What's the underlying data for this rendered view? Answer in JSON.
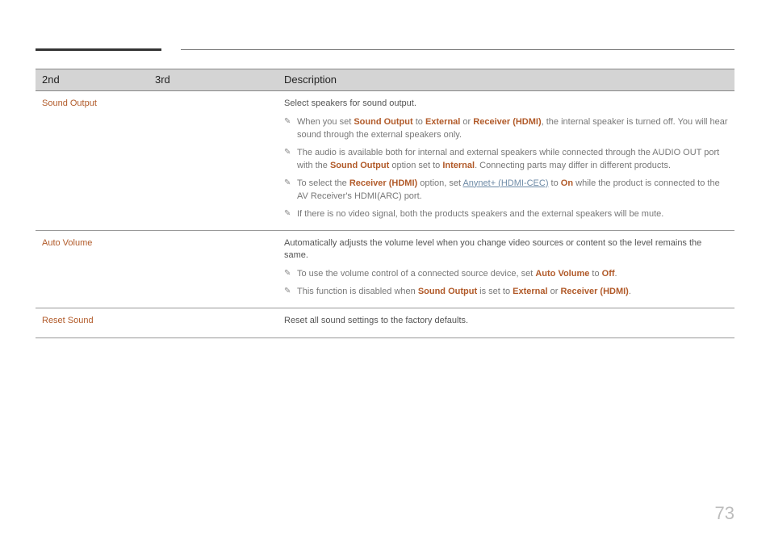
{
  "headers": {
    "col1": "2nd",
    "col2": "3rd",
    "col3": "Description"
  },
  "rows": [
    {
      "menu": "Sound Output",
      "desc_main": "Select speakers for sound output.",
      "notes": [
        [
          {
            "t": "When you set "
          },
          {
            "t": "Sound Output",
            "c": "hl-bold"
          },
          {
            "t": " to "
          },
          {
            "t": "External",
            "c": "hl-bold"
          },
          {
            "t": " or "
          },
          {
            "t": "Receiver (HDMI)",
            "c": "hl-bold"
          },
          {
            "t": ", the internal speaker is turned off. You will hear sound through the external speakers only."
          }
        ],
        [
          {
            "t": "The audio is available both for internal and external speakers while connected through the AUDIO OUT port with the "
          },
          {
            "t": "Sound Output",
            "c": "hl-bold"
          },
          {
            "t": " option set to "
          },
          {
            "t": "Internal",
            "c": "hl-bold"
          },
          {
            "t": ". Connecting parts may differ in different products."
          }
        ],
        [
          {
            "t": "To select the "
          },
          {
            "t": "Receiver (HDMI)",
            "c": "hl-bold"
          },
          {
            "t": " option, set "
          },
          {
            "t": "Anynet+ (HDMI-CEC)",
            "c": "link"
          },
          {
            "t": " to "
          },
          {
            "t": "On",
            "c": "hl-bold"
          },
          {
            "t": " while the product is connected to the AV Receiver's HDMI(ARC) port."
          }
        ],
        [
          {
            "t": "If there is no video signal, both the products speakers and the external speakers will be mute."
          }
        ]
      ]
    },
    {
      "menu": "Auto Volume",
      "desc_main": "Automatically adjusts the volume level when you change video sources or content so the level remains the same.",
      "notes": [
        [
          {
            "t": "To use the volume control of a connected source device, set "
          },
          {
            "t": "Auto Volume",
            "c": "hl-bold"
          },
          {
            "t": " to "
          },
          {
            "t": "Off",
            "c": "hl-bold"
          },
          {
            "t": "."
          }
        ],
        [
          {
            "t": "This function is disabled when "
          },
          {
            "t": "Sound Output",
            "c": "hl-bold"
          },
          {
            "t": " is set to "
          },
          {
            "t": "External",
            "c": "hl-bold"
          },
          {
            "t": " or "
          },
          {
            "t": "Receiver (HDMI)",
            "c": "hl-bold"
          },
          {
            "t": "."
          }
        ]
      ]
    },
    {
      "menu": "Reset Sound",
      "desc_main": "Reset all sound settings to the factory defaults.",
      "notes": []
    }
  ],
  "page_number": "73"
}
